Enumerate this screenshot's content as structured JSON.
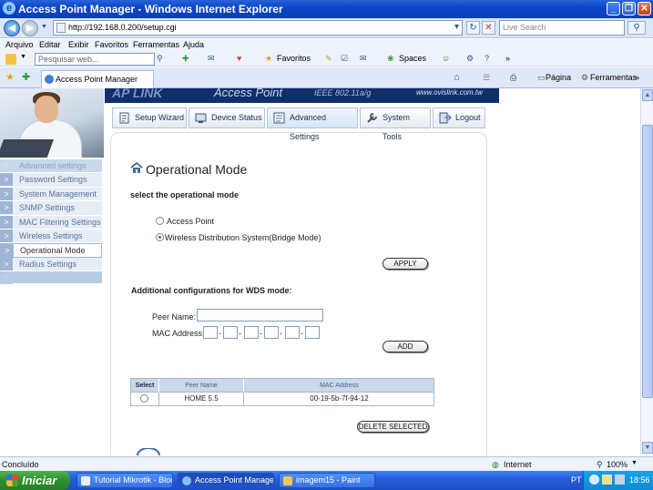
{
  "window": {
    "title": "Access Point Manager - Windows Internet Explorer",
    "minimize": "_",
    "maximize": "❐",
    "close": "✕"
  },
  "addressbar": {
    "url": "http://192.168.0.200/setup.cgi",
    "search_placeholder": "Live Search"
  },
  "menu": {
    "items": [
      "Arquivo",
      "Editar",
      "Exibir",
      "Favoritos",
      "Ferramentas",
      "Ajuda"
    ]
  },
  "toolbar": {
    "search_placeholder": "Pesquisar web...",
    "favoritos": "Favoritos",
    "spaces": "Spaces"
  },
  "tabs": {
    "active_tab": "Access Point Manager",
    "pagina": "Página",
    "ferramentas": "Ferramentas"
  },
  "banner": {
    "brand": "AP LINK",
    "product": "Access Point",
    "standard": "IEEE 802.11a/g",
    "url": "www.ovislink.com.tw"
  },
  "topnav": [
    {
      "label": "Setup Wizard",
      "selected": false
    },
    {
      "label": "Device Status",
      "selected": false
    },
    {
      "label": "Advanced Settings",
      "selected": true
    },
    {
      "label": "System Tools",
      "selected": false
    },
    {
      "label": "Logout",
      "selected": false
    }
  ],
  "sidebar": {
    "header": "Advanced settings",
    "items": [
      {
        "label": "Password Settings",
        "active": false
      },
      {
        "label": "System Management",
        "active": false
      },
      {
        "label": "SNMP Settings",
        "active": false
      },
      {
        "label": "MAC Filtering Settings",
        "active": false
      },
      {
        "label": "Wireless Settings",
        "active": false
      },
      {
        "label": "Operational Mode",
        "active": true
      },
      {
        "label": "Radius Settings",
        "active": false
      }
    ]
  },
  "page": {
    "title": "Operational Mode",
    "subtitle": "select the operational mode",
    "modes": [
      {
        "label": "Access Point",
        "checked": false
      },
      {
        "label": "Wireless Distribution System(Bridge Mode)",
        "checked": true
      }
    ],
    "apply_label": "APPLY",
    "wds_heading": "Additional configurations for WDS mode:",
    "peer_name_label": "Peer Name:",
    "mac_label": "MAC Address:",
    "add_label": "ADD",
    "table": {
      "headers": [
        "Select",
        "Peer Name",
        "MAC Address"
      ],
      "rows": [
        {
          "peer_name": "HOME 5.5",
          "mac": "00-19-5b-7f-94-12"
        }
      ]
    },
    "delete_label": "DELETE SELECTED"
  },
  "statusbar": {
    "left": "Concluído",
    "zone": "Internet",
    "zoom": "100%"
  },
  "taskbar": {
    "start": "Iniciar",
    "tasks": [
      {
        "label": "Tutorial Mikrotik - Bloc...",
        "active": false
      },
      {
        "label": "Access Point Manage...",
        "active": true
      },
      {
        "label": "imagem15 - Paint",
        "active": false
      }
    ],
    "lang": "PT",
    "clock": "18:56"
  },
  "colors": {
    "xp_blue": "#0a46c6",
    "banner": "#0e2f6a",
    "sidebar": "#e7edf5"
  }
}
